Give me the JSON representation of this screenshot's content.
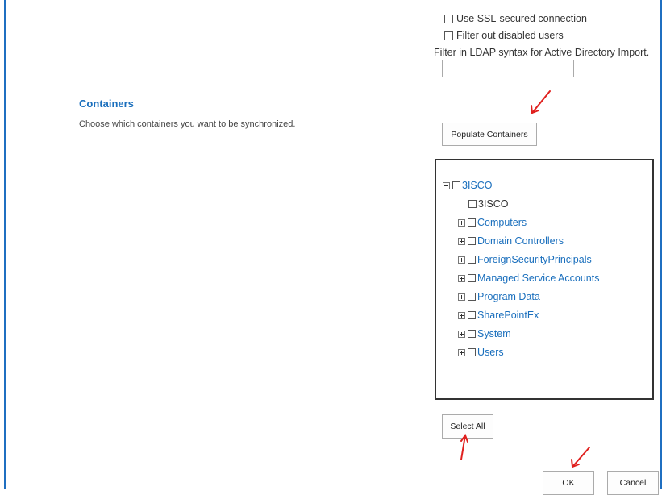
{
  "options": {
    "ssl_label": "Use SSL-secured connection",
    "filter_disabled_label": "Filter out disabled users",
    "ldap_label": "Filter in LDAP syntax for Active Directory Import.",
    "ldap_value": ""
  },
  "containers": {
    "title": "Containers",
    "description": "Choose which containers you want to be synchronized.",
    "populate_label": "Populate Containers",
    "select_all_label": "Select All",
    "tree": {
      "root": "3ISCO",
      "self": "3ISCO",
      "children": [
        "Computers",
        "Domain Controllers",
        "ForeignSecurityPrincipals",
        "Managed Service Accounts",
        "Program Data",
        "SharePointEx",
        "System",
        "Users"
      ]
    }
  },
  "footer": {
    "ok_label": "OK",
    "cancel_label": "Cancel"
  },
  "colors": {
    "accent": "#1a6fbd",
    "annotation_arrow": "#e0201e",
    "frame_border": "#1f6fc1"
  },
  "icons": {
    "annotation": "red-arrow-icon",
    "expand": "plus-box-icon",
    "collapse": "minus-box-icon"
  }
}
